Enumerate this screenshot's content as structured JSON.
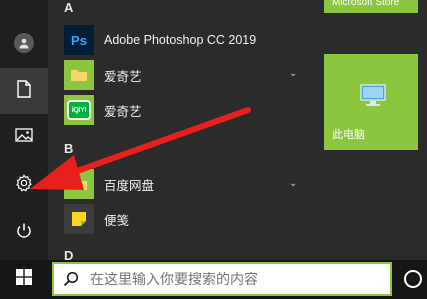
{
  "start_menu": {
    "groups": [
      {
        "letter": "A",
        "apps": [
          {
            "label": "Adobe Photoshop CC 2019",
            "icon": "photoshop-icon",
            "icon_text": "Ps"
          },
          {
            "label": "爱奇艺",
            "icon": "folder-icon",
            "expandable": true
          },
          {
            "label": "爱奇艺",
            "icon": "iqiyi-icon",
            "icon_text": "iQIYI"
          }
        ]
      },
      {
        "letter": "B",
        "apps": [
          {
            "label": "百度网盘",
            "icon": "folder-icon",
            "expandable": true
          },
          {
            "label": "便笺",
            "icon": "sticky-notes-icon"
          }
        ]
      },
      {
        "letter": "D",
        "apps": []
      }
    ],
    "rail": [
      "user-avatar-icon",
      "documents-icon",
      "pictures-icon",
      "settings-icon",
      "power-icon"
    ],
    "tiles": {
      "top_label": "Microsoft Store",
      "pc_label": "此电脑"
    }
  },
  "taskbar": {
    "search_text": "在这里输入你要搜索的内容"
  },
  "colors": {
    "accent": "#8cc63f",
    "arrow": "#e8201c",
    "menu_bg": "#2b2b2b",
    "rail_bg": "#1f1f1f",
    "taskbar_bg": "#161616"
  }
}
